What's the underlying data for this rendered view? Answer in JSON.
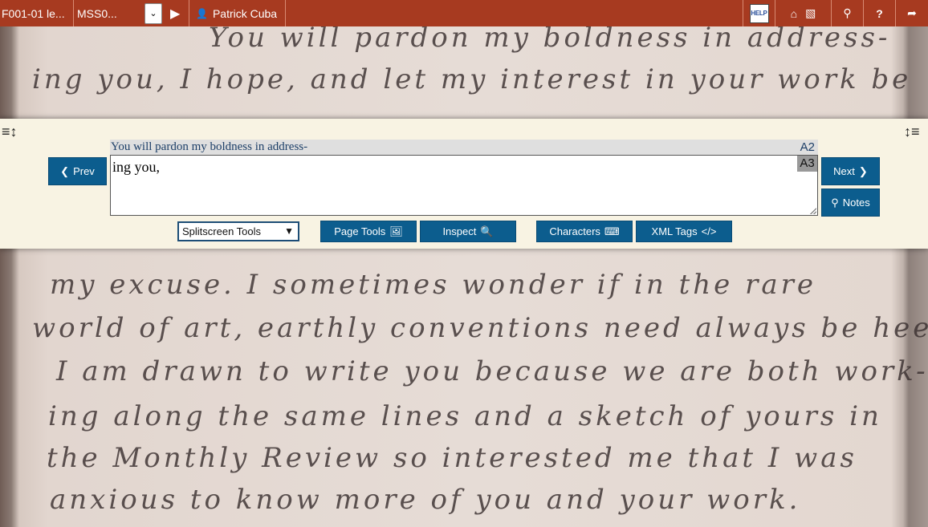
{
  "topbar": {
    "doc_title": "F001-01 le...",
    "ms_select": "MSS0...",
    "user_name": "Patrick Cuba",
    "help_label": "HELP"
  },
  "manuscript": {
    "lines": [
      "You will pardon my boldness in address-",
      "ing you, I hope, and let my interest in your work be",
      "my excuse. I sometimes wonder if in the rare",
      "world of art, earthly conventions need always be heeded.",
      "I am drawn to write you because we are both work-",
      "ing along the same lines and a sketch of yours in",
      "the Monthly Review so interested me that I was",
      "anxious to know more of you and your work."
    ]
  },
  "editor": {
    "previous_line": "You will pardon my boldness in address-",
    "previous_tag": "A2",
    "current_text": "ing you,",
    "current_tag": "A3",
    "prev_label": "Prev",
    "next_label": "Next",
    "notes_label": "Notes"
  },
  "toolbar": {
    "splitscreen_selected": "Splitscreen Tools",
    "page_tools_label": "Page Tools",
    "inspect_label": "Inspect",
    "characters_label": "Characters",
    "xml_tags_label": "XML Tags"
  },
  "colors": {
    "topbar": "#a73a20",
    "button": "#0c5d8e",
    "panel": "#f8f3e3"
  }
}
